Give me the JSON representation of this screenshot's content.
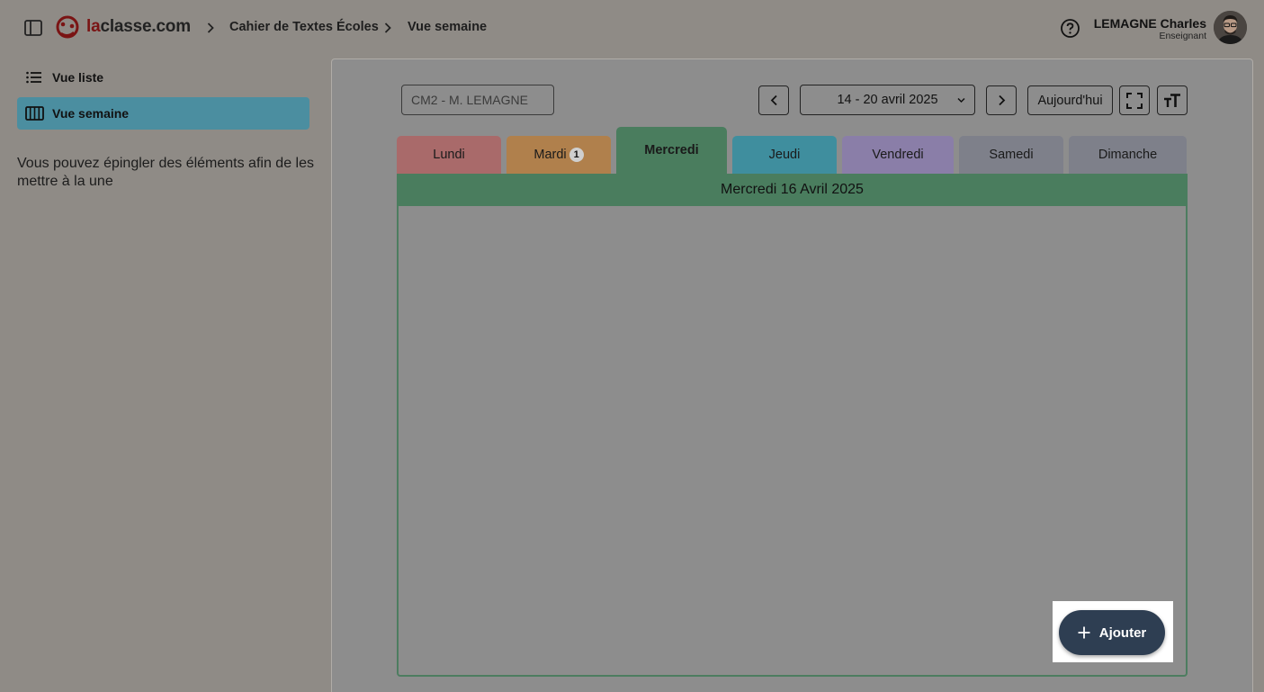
{
  "header": {
    "logo": {
      "prefix": "la",
      "rest": "classe.com"
    },
    "breadcrumbs": [
      "Cahier de Textes Écoles",
      "Vue semaine"
    ],
    "user": {
      "name": "LEMAGNE Charles",
      "role": "Enseignant"
    }
  },
  "sidebar": {
    "items": [
      {
        "label": "Vue liste",
        "icon": "list-icon",
        "active": false
      },
      {
        "label": "Vue semaine",
        "icon": "week-columns-icon",
        "active": true
      }
    ],
    "note": "Vous pouvez épingler des éléments afin de les mettre à la une"
  },
  "toolbar": {
    "class_select_value": "CM2 - M. LEMAGNE",
    "week_range": "14 - 20 avril 2025",
    "today_label": "Aujourd'hui"
  },
  "tabs": [
    {
      "label": "Lundi",
      "color": "#a96a6a",
      "badge": ""
    },
    {
      "label": "Mardi",
      "color": "#b0804c",
      "badge": "1"
    },
    {
      "label": "Mercredi",
      "color": "#4a7d5e",
      "badge": "",
      "active": true
    },
    {
      "label": "Jeudi",
      "color": "#3f8e9e",
      "badge": ""
    },
    {
      "label": "Vendredi",
      "color": "#8a7ea8",
      "badge": ""
    },
    {
      "label": "Samedi",
      "color": "#7e808a",
      "badge": ""
    },
    {
      "label": "Dimanche",
      "color": "#7e808a",
      "badge": ""
    }
  ],
  "day_panel": {
    "title": "Mercredi 16 Avril 2025"
  },
  "fab": {
    "label": "Ajouter"
  },
  "colors": {
    "accent_active_nav": "#4b8ea0",
    "fab_background": "#2e3e52",
    "brand_red": "#7a1414"
  }
}
